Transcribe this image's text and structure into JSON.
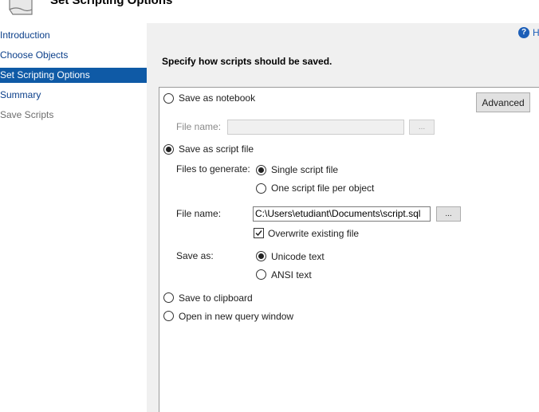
{
  "header": {
    "title": "Set Scripting Options"
  },
  "sidebar": {
    "items": [
      {
        "label": "Introduction"
      },
      {
        "label": "Choose Objects"
      },
      {
        "label": "Set Scripting Options"
      },
      {
        "label": "Summary"
      },
      {
        "label": "Save Scripts"
      }
    ],
    "active_index": 2
  },
  "help": {
    "label": "H"
  },
  "main": {
    "instruction": "Specify how scripts should be saved.",
    "save_as_notebook": {
      "label": "Save as notebook",
      "selected": false,
      "file_name_label": "File name:",
      "file_name_value": "",
      "browse_label": "..."
    },
    "advanced_button": "Advanced",
    "save_as_script_file": {
      "label": "Save as script file",
      "selected": true,
      "files_to_generate_label": "Files to generate:",
      "single_file_label": "Single script file",
      "single_file_selected": true,
      "one_per_object_label": "One script file per object",
      "one_per_object_selected": false,
      "file_name_label": "File name:",
      "file_name_value": "C:\\Users\\etudiant\\Documents\\script.sql",
      "browse_label": "...",
      "overwrite_label": "Overwrite existing file",
      "overwrite_checked": true,
      "save_as_label": "Save as:",
      "unicode_label": "Unicode text",
      "unicode_selected": true,
      "ansi_label": "ANSI text",
      "ansi_selected": false
    },
    "save_to_clipboard": {
      "label": "Save to clipboard",
      "selected": false
    },
    "open_query_window": {
      "label": "Open in new query window",
      "selected": false
    }
  }
}
